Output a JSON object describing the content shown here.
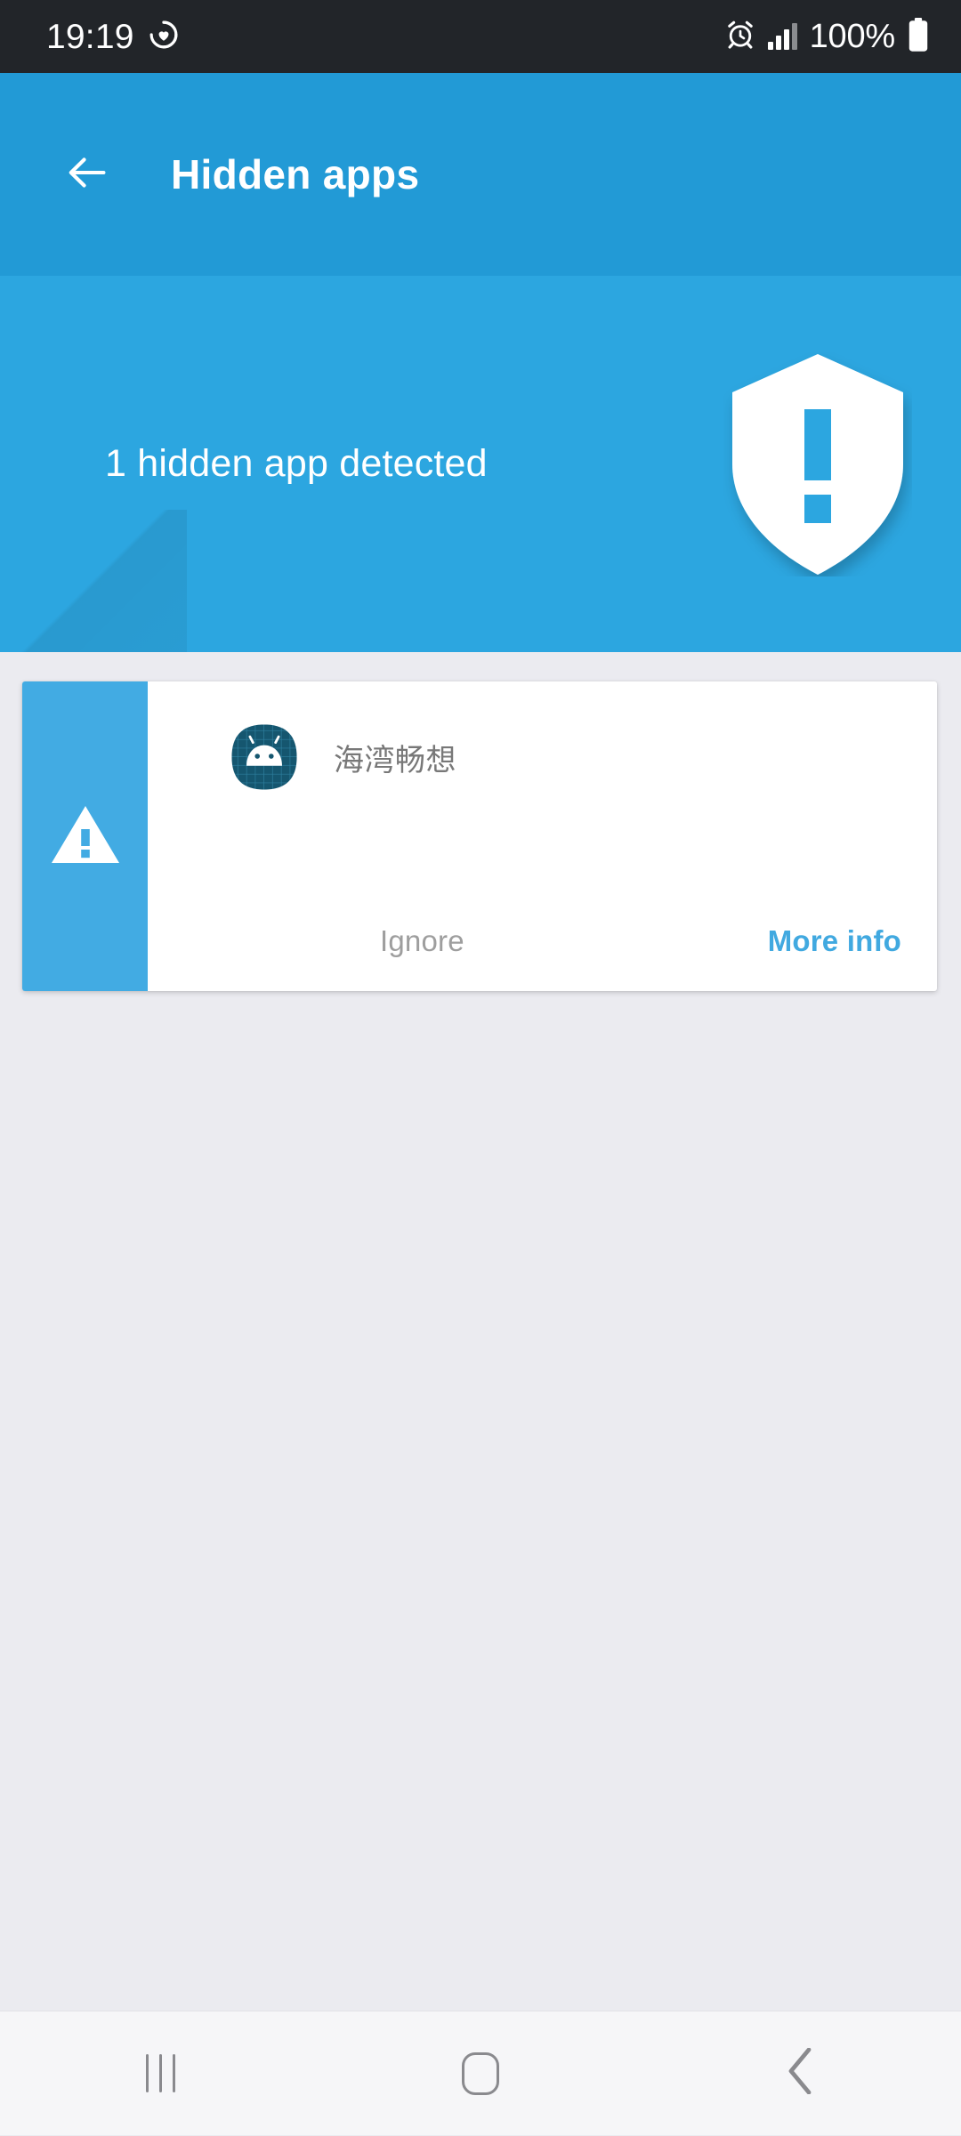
{
  "status_bar": {
    "time": "19:19",
    "battery_percent": "100%",
    "icons": {
      "activity": "heart-circle-icon",
      "alarm": "alarm-clock-icon",
      "signal": "signal-bars-icon",
      "battery": "battery-full-icon"
    }
  },
  "header": {
    "back_icon": "back-arrow-icon",
    "title": "Hidden apps"
  },
  "hero": {
    "message": "1 hidden app detected",
    "icon": "shield-exclamation-icon"
  },
  "card": {
    "warning_icon": "warning-triangle-icon",
    "app_icon": "android-robot-icon",
    "app_name": "海湾畅想",
    "ignore_label": "Ignore",
    "more_info_label": "More info"
  },
  "nav_bar": {
    "recents_icon": "recents-icon",
    "home_icon": "home-icon",
    "back_icon": "back-chevron-icon"
  },
  "colors": {
    "status_bar_bg": "#222529",
    "header_blue": "#229ad6",
    "hero_blue": "#2ca6e0",
    "strip_blue": "#42abe3",
    "accent_blue": "#41a9e0",
    "page_bg": "#ebebf0",
    "card_bg": "#ffffff",
    "muted_text": "#9e9e9e",
    "app_name_text": "#787878",
    "app_icon_base": "#15566f",
    "app_icon_grid": "#2d7f9e",
    "nav_icon": "#8a8a8e"
  }
}
